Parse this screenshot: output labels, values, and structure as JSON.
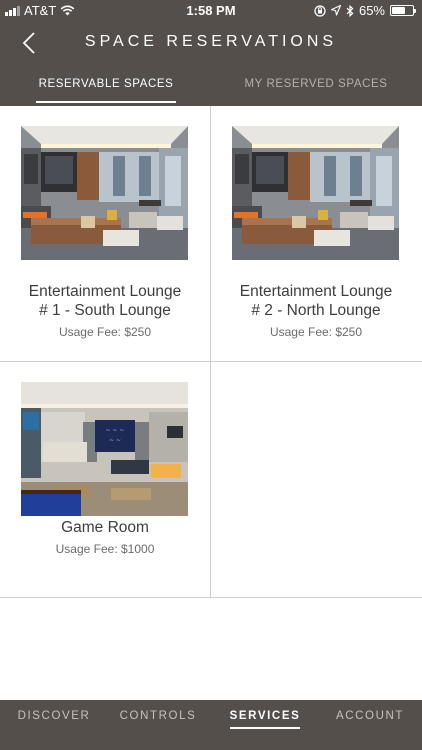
{
  "status_bar": {
    "carrier": "AT&T",
    "time": "1:58 PM",
    "battery": "65%",
    "battery_level": 0.65
  },
  "header": {
    "title": "SPACE RESERVATIONS"
  },
  "tabs": [
    {
      "label": "RESERVABLE SPACES",
      "active": true
    },
    {
      "label": "MY RESERVED SPACES",
      "active": false
    }
  ],
  "spaces": [
    {
      "name_line1": "Entertainment Lounge",
      "name_line2": "# 1 - South Lounge",
      "fee": "Usage Fee: $250"
    },
    {
      "name_line1": "Entertainment Lounge",
      "name_line2": "# 2 - North Lounge",
      "fee": "Usage Fee: $250"
    },
    {
      "name_line1": "Game Room",
      "fee": "Usage Fee: $1000"
    }
  ],
  "bottom_nav": [
    {
      "label": "DISCOVER",
      "active": false
    },
    {
      "label": "CONTROLS",
      "active": false
    },
    {
      "label": "SERVICES",
      "active": true
    },
    {
      "label": "ACCOUNT",
      "active": false
    }
  ],
  "colors": {
    "bar_background": "#544f4a",
    "divider": "#cfcfcf",
    "text_dark": "#3e3e3e"
  }
}
